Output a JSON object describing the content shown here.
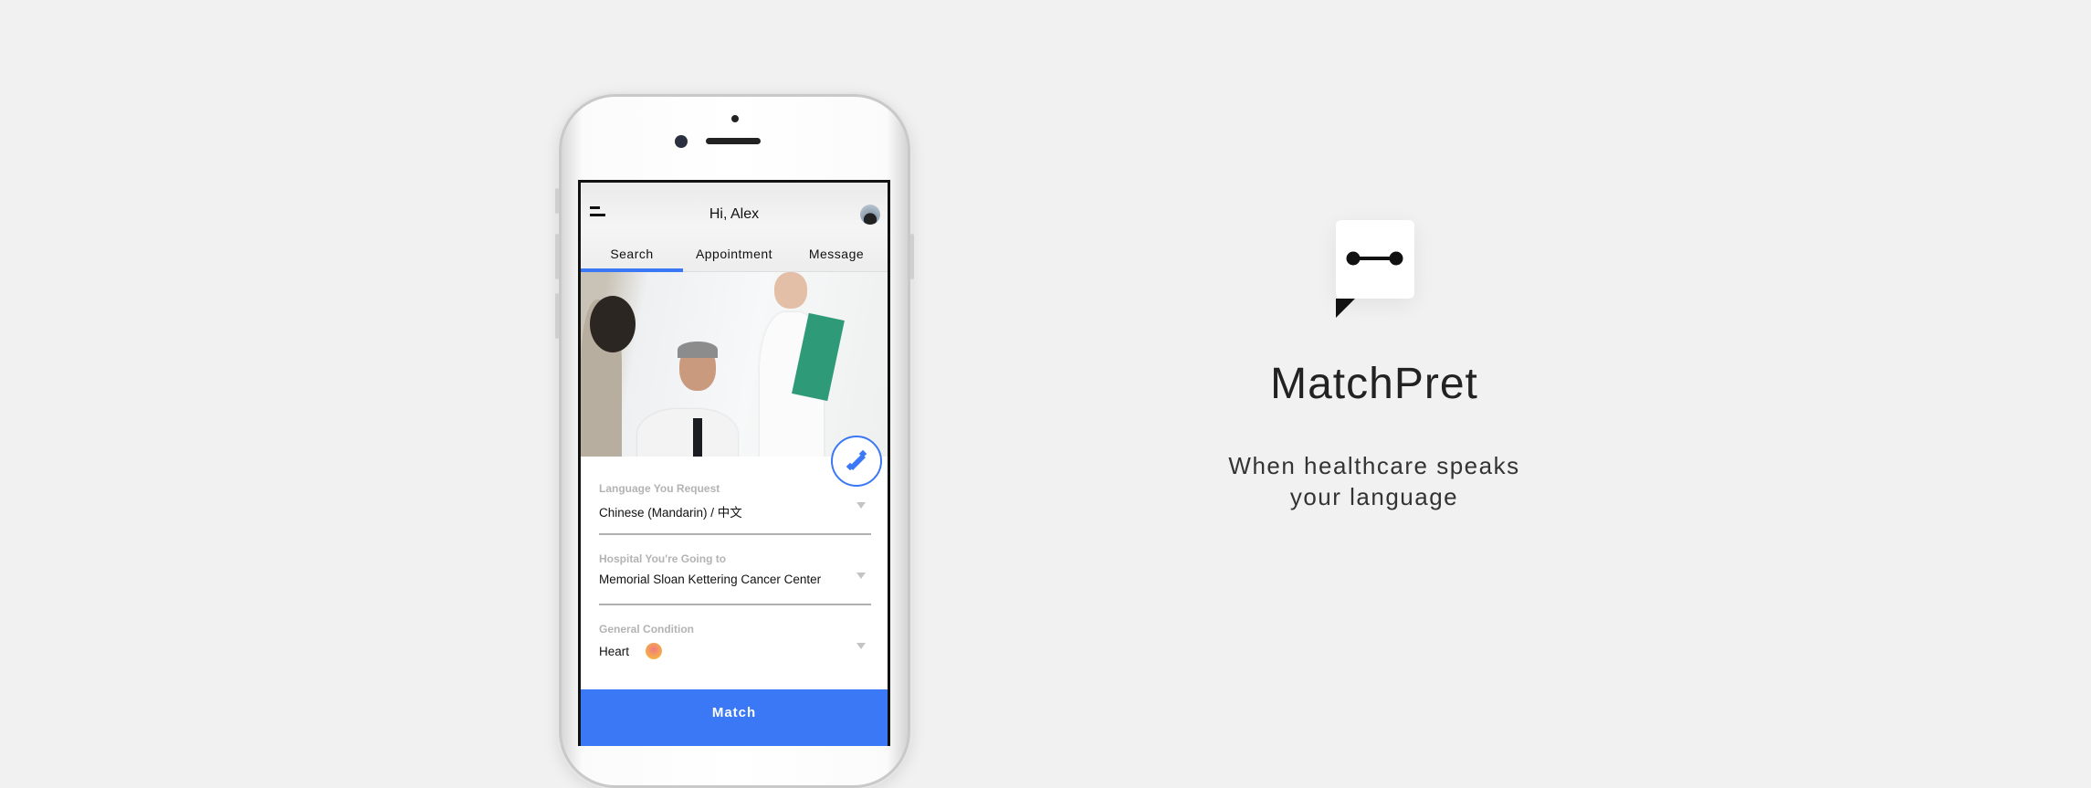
{
  "app": {
    "greeting": "Hi, Alex",
    "tabs": [
      {
        "label": "Search"
      },
      {
        "label": "Appointment"
      },
      {
        "label": "Message"
      }
    ],
    "active_tab": "Search",
    "fields": [
      {
        "label": "Language You Request",
        "value": "Chinese (Mandarin) / 中文"
      },
      {
        "label": "Hospital You're Going to",
        "value": "Memorial Sloan Kettering Cancer Center"
      },
      {
        "label": "General Condition",
        "value": "Heart"
      }
    ],
    "match_label": "Match"
  },
  "brand": {
    "name": "MatchPret",
    "tagline_line1": "When healthcare speaks",
    "tagline_line2": "your language"
  },
  "colors": {
    "accent": "#3b78f5",
    "background": "#f1f1f1"
  }
}
